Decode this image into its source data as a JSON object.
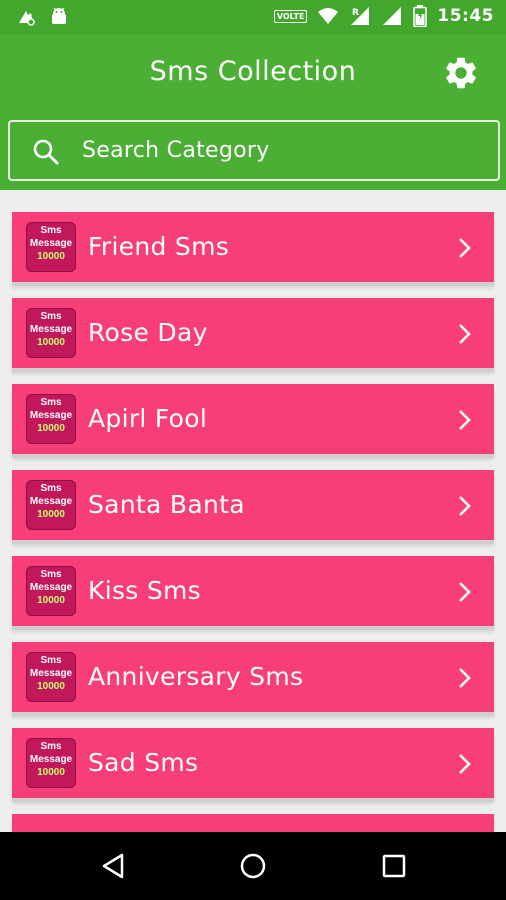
{
  "status_bar": {
    "time": "15:45",
    "volte": "VOLTE",
    "icons": [
      "notification-icon",
      "android-icon",
      "volte-icon",
      "wifi-icon",
      "signal-r-icon",
      "signal-icon",
      "battery-icon"
    ]
  },
  "app_bar": {
    "title": "Sms Collection",
    "settings_icon": "gear-icon"
  },
  "search": {
    "placeholder": "Search Category",
    "icon": "search-icon"
  },
  "badge": {
    "line1": "Sms",
    "line2": "Message",
    "line3": "10000"
  },
  "categories": [
    {
      "label": "Friend Sms"
    },
    {
      "label": "Rose Day"
    },
    {
      "label": "Apirl Fool"
    },
    {
      "label": "Santa Banta"
    },
    {
      "label": "Kiss Sms"
    },
    {
      "label": "Anniversary Sms"
    },
    {
      "label": "Sad Sms"
    }
  ],
  "colors": {
    "status_bar": "#43a72d",
    "app_bar": "#4caf35",
    "item": "#f73e78",
    "badge": "#c2185b",
    "background": "#eeeeee"
  },
  "nav_bar": {
    "icons": [
      "back-icon",
      "home-icon",
      "recents-icon"
    ]
  }
}
